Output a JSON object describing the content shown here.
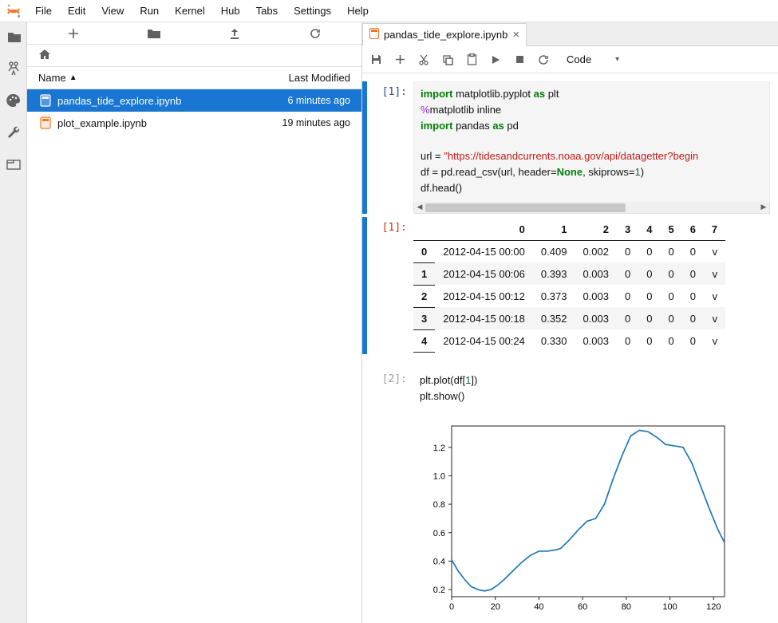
{
  "menu": {
    "items": [
      "File",
      "Edit",
      "View",
      "Run",
      "Kernel",
      "Hub",
      "Tabs",
      "Settings",
      "Help"
    ]
  },
  "sidebar": {
    "header": {
      "name": "Name",
      "modified": "Last Modified"
    },
    "rows": [
      {
        "name": "pandas_tide_explore.ipynb",
        "modified": "6 minutes ago",
        "selected": true
      },
      {
        "name": "plot_example.ipynb",
        "modified": "19 minutes ago",
        "selected": false
      }
    ]
  },
  "tab": {
    "title": "pandas_tide_explore.ipynb"
  },
  "celltype": "Code",
  "prompts": {
    "in1": "[1]:",
    "out1": "[1]:",
    "in2": "[2]:"
  },
  "code1": {
    "l1a": "import",
    "l1b": " matplotlib.pyplot ",
    "l1c": "as",
    "l1d": " plt",
    "l2a": "%",
    "l2b": "matplotlib inline",
    "l3a": "import",
    "l3b": " pandas ",
    "l3c": "as",
    "l3d": " pd",
    "l4a": "url = ",
    "l4b": "\"https://tidesandcurrents.noaa.gov/api/datagetter?begin",
    "l5a": "df = pd.read_csv(url, header=",
    "l5b": "None",
    "l5c": ", skiprows=",
    "l5d": "1",
    "l5e": ")",
    "l6": "df.head()"
  },
  "code2": {
    "l1a": "plt.plot(df[",
    "l1b": "1",
    "l1c": "])",
    "l2": "plt.show()"
  },
  "df": {
    "cols": [
      "0",
      "1",
      "2",
      "3",
      "4",
      "5",
      "6",
      "7"
    ],
    "rows": [
      {
        "idx": "0",
        "c0": "2012-04-15 00:00",
        "c1": "0.409",
        "c2": "0.002",
        "c3": "0",
        "c4": "0",
        "c5": "0",
        "c6": "0",
        "c7": "v"
      },
      {
        "idx": "1",
        "c0": "2012-04-15 00:06",
        "c1": "0.393",
        "c2": "0.003",
        "c3": "0",
        "c4": "0",
        "c5": "0",
        "c6": "0",
        "c7": "v"
      },
      {
        "idx": "2",
        "c0": "2012-04-15 00:12",
        "c1": "0.373",
        "c2": "0.003",
        "c3": "0",
        "c4": "0",
        "c5": "0",
        "c6": "0",
        "c7": "v"
      },
      {
        "idx": "3",
        "c0": "2012-04-15 00:18",
        "c1": "0.352",
        "c2": "0.003",
        "c3": "0",
        "c4": "0",
        "c5": "0",
        "c6": "0",
        "c7": "v"
      },
      {
        "idx": "4",
        "c0": "2012-04-15 00:24",
        "c1": "0.330",
        "c2": "0.003",
        "c3": "0",
        "c4": "0",
        "c5": "0",
        "c6": "0",
        "c7": "v"
      }
    ]
  },
  "chart_data": {
    "type": "line",
    "title": "",
    "xlabel": "",
    "ylabel": "",
    "xlim": [
      0,
      125
    ],
    "ylim": [
      0.15,
      1.35
    ],
    "xticks": [
      0,
      20,
      40,
      60,
      80,
      100,
      120
    ],
    "yticks": [
      0.2,
      0.4,
      0.6,
      0.8,
      1.0,
      1.2
    ],
    "series": [
      {
        "name": "df[1]",
        "x": [
          0,
          3,
          6,
          9,
          12,
          15,
          18,
          21,
          24,
          28,
          32,
          36,
          40,
          44,
          48,
          50,
          54,
          58,
          62,
          66,
          70,
          74,
          78,
          82,
          86,
          90,
          94,
          98,
          102,
          106,
          110,
          114,
          118,
          122,
          125
        ],
        "y": [
          0.41,
          0.33,
          0.27,
          0.22,
          0.2,
          0.19,
          0.2,
          0.23,
          0.27,
          0.33,
          0.39,
          0.44,
          0.47,
          0.47,
          0.48,
          0.49,
          0.55,
          0.62,
          0.68,
          0.7,
          0.8,
          0.98,
          1.14,
          1.28,
          1.32,
          1.31,
          1.27,
          1.22,
          1.21,
          1.2,
          1.09,
          0.93,
          0.77,
          0.62,
          0.53
        ]
      }
    ]
  }
}
